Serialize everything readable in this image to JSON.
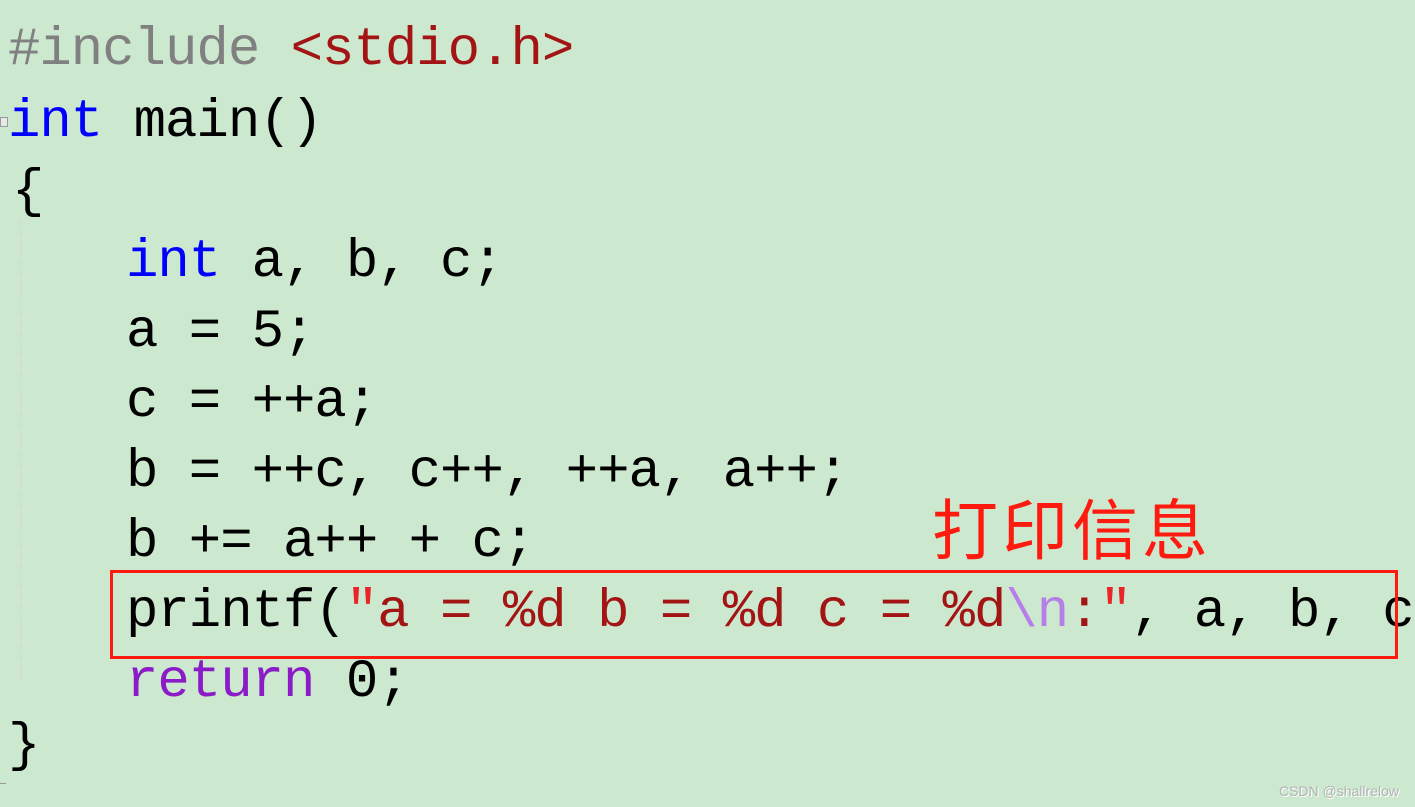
{
  "code": {
    "include": {
      "directive": "#include",
      "header": "<stdio.h>"
    },
    "main_sig": {
      "type": "int",
      "rest": "main()"
    },
    "open_brace": "{",
    "decl": {
      "type": "int",
      "rest": "a, b, c;"
    },
    "lines": [
      "a = 5;",
      "c = ++a;",
      "b = ++c, c++, ++a, a++;",
      "b += a++ + c;"
    ],
    "printf": {
      "fn": "printf(",
      "quote_open": "″",
      "fmt": "a = %d b = %d c = %d",
      "escape": "\\n",
      "colon": ":",
      "quote_close": "″",
      "args": ", a, b, c);"
    },
    "return": {
      "keyword": "return",
      "rest": " 0;"
    },
    "close_brace": "}"
  },
  "annotation": {
    "text": "打印信息",
    "color": "#ff1a10"
  },
  "watermark": "CSDN @shallrelow",
  "colors": {
    "background": "#cce8cf",
    "keyword": "#0000ff",
    "string": "#a31515",
    "return_keyword": "#8a1bc6",
    "escape": "#b57ee8",
    "preprocessor": "#808080"
  }
}
